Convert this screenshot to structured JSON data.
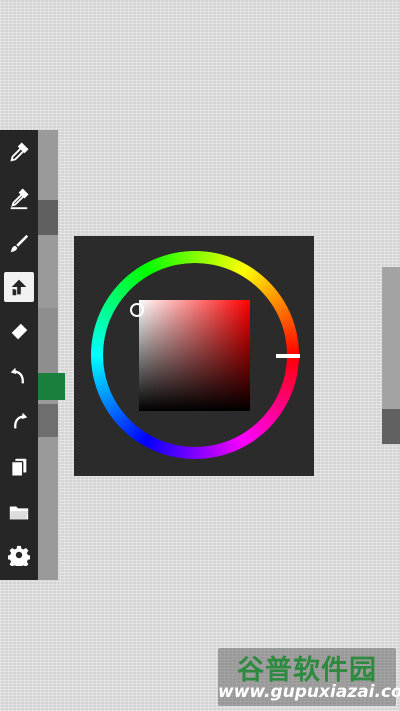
{
  "toolbar": {
    "items": [
      {
        "name": "eyedropper-icon"
      },
      {
        "name": "eyedropper-edit-icon"
      },
      {
        "name": "brush-icon"
      },
      {
        "name": "fill-icon",
        "active": true
      },
      {
        "name": "eraser-icon"
      },
      {
        "name": "undo-icon"
      },
      {
        "name": "redo-icon"
      },
      {
        "name": "layers-icon"
      },
      {
        "name": "folder-icon"
      },
      {
        "name": "settings-gear-icon"
      }
    ]
  },
  "colors": {
    "current_color": "#18803a",
    "hue_color": "#ff0000",
    "toolbar_bg": "#262626",
    "picker_bg": "#2b2b2b"
  },
  "watermark": {
    "logo": "谷普软件园",
    "url": "www.gupuxiazai.com"
  }
}
